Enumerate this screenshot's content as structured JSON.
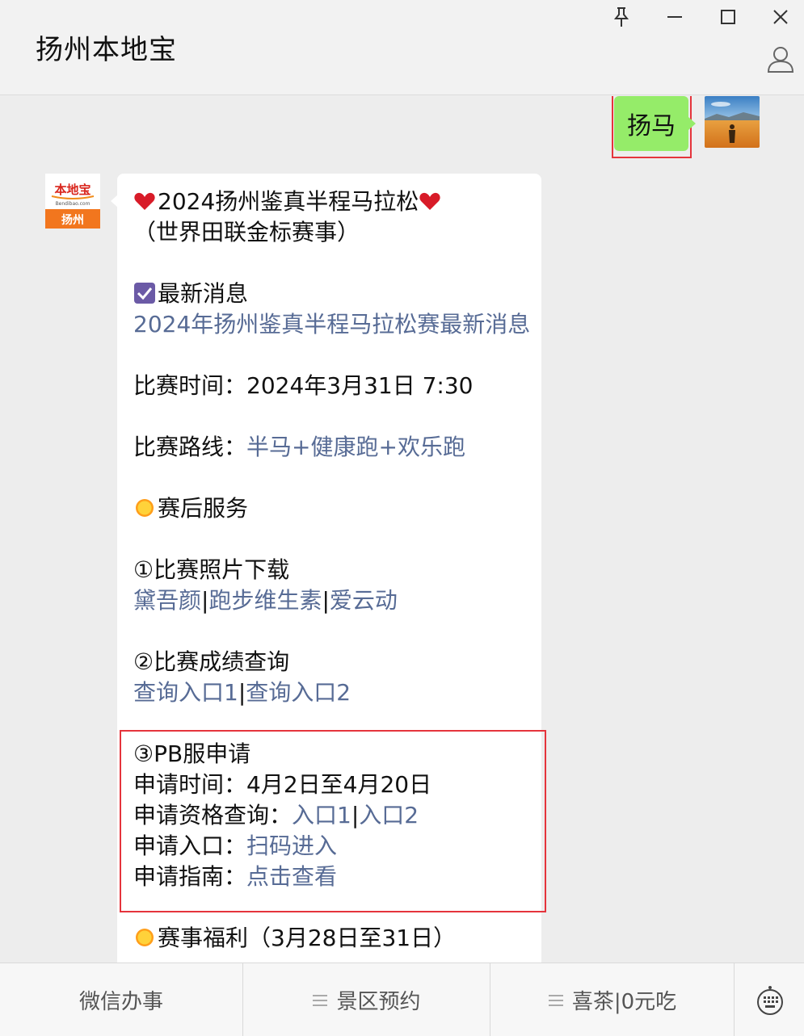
{
  "window": {
    "title": "扬州本地宝",
    "controls": [
      "pin",
      "minimize",
      "maximize",
      "close"
    ]
  },
  "user_message": {
    "text": "扬马"
  },
  "bot_avatar": {
    "logo_top": "本地宝",
    "logo_url": "Bendibao.com",
    "logo_city": "扬州"
  },
  "bot_message": {
    "headline": "2024扬州鉴真半程马拉松",
    "subheadline": "（世界田联金标赛事）",
    "news_label": "最新消息",
    "news_link": "2024年扬州鉴真半程马拉松赛最新消息",
    "race_time_label": "比赛时间：",
    "race_time_value": "2024年3月31日 7:30",
    "route_label": "比赛路线：",
    "route_links": [
      "半马",
      "健康跑",
      "欢乐跑"
    ],
    "route_sep": "+",
    "service_label": "赛后服务",
    "photo_label": "①比赛照片下载",
    "photo_links": [
      "黛吾颜",
      "跑步维生素",
      "爱云动"
    ],
    "result_label": "②比赛成绩查询",
    "result_links": [
      "查询入口1",
      "查询入口2"
    ],
    "pb_label": "③PB服申请",
    "pb_time_label": "申请时间：",
    "pb_time_value": "4月2日至4月20日",
    "pb_qual_label": "申请资格查询：",
    "pb_qual_links": [
      "入口1",
      "入口2"
    ],
    "pb_entry_label": "申请入口：",
    "pb_entry_link": "扫码进入",
    "pb_guide_label": "申请指南：",
    "pb_guide_link": "点击查看",
    "welfare_label": "赛事福利（3月28日至31日）",
    "separator": "|"
  },
  "bottom_menu": {
    "items": [
      "微信办事",
      "景区预约",
      "喜茶|0元吃"
    ]
  },
  "colors": {
    "link": "#576b95",
    "user_bubble": "#95ec69",
    "highlight_border": "#e5343c"
  }
}
